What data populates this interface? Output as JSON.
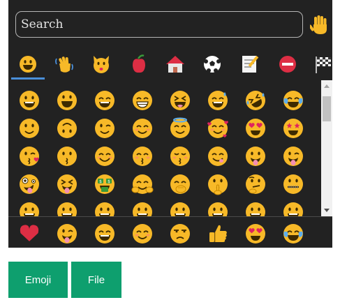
{
  "search": {
    "placeholder": "Search",
    "value": ""
  },
  "skin_tone_icon": "raised-hand-icon",
  "categories": [
    {
      "icon": "smileys-icon",
      "active": true
    },
    {
      "icon": "people-icon",
      "active": false
    },
    {
      "icon": "animals-icon",
      "active": false
    },
    {
      "icon": "food-icon",
      "active": false
    },
    {
      "icon": "travel-icon",
      "active": false
    },
    {
      "icon": "activities-icon",
      "active": false
    },
    {
      "icon": "objects-icon",
      "active": false
    },
    {
      "icon": "symbols-icon",
      "active": false
    },
    {
      "icon": "flags-icon",
      "active": false
    }
  ],
  "grid_rows": [
    [
      "grinning",
      "smiley",
      "grin-smile",
      "beaming",
      "laughing-squint",
      "sweat-smile",
      "rofl",
      "tears-of-joy"
    ],
    [
      "slight-smile",
      "upside-down",
      "wink",
      "blush",
      "halo",
      "smiling-hearts",
      "heart-eyes",
      "star-struck"
    ],
    [
      "kiss-heart",
      "kissing",
      "relaxed",
      "kissing-smiling",
      "kissing-closed",
      "yum",
      "tongue",
      "winking-tongue"
    ],
    [
      "zany",
      "squint-tongue",
      "money-mouth",
      "hugging",
      "hand-over-mouth",
      "shushing",
      "thinking",
      "zipper-mouth"
    ],
    [
      "grinning",
      "grinning",
      "grinning",
      "grinning",
      "grinning",
      "grinning",
      "grinning",
      "grinning"
    ]
  ],
  "recent": [
    "red-heart",
    "winking-tongue",
    "grin-smile",
    "blush",
    "unamused",
    "thumbs-up",
    "heart-eyes",
    "tears-of-joy"
  ],
  "colors": {
    "panel": "#222222",
    "face": "#f7b928",
    "accent": "#4a8fd9",
    "button": "#0e9f6e"
  },
  "buttons": {
    "emoji": "Emoji",
    "file": "File"
  }
}
